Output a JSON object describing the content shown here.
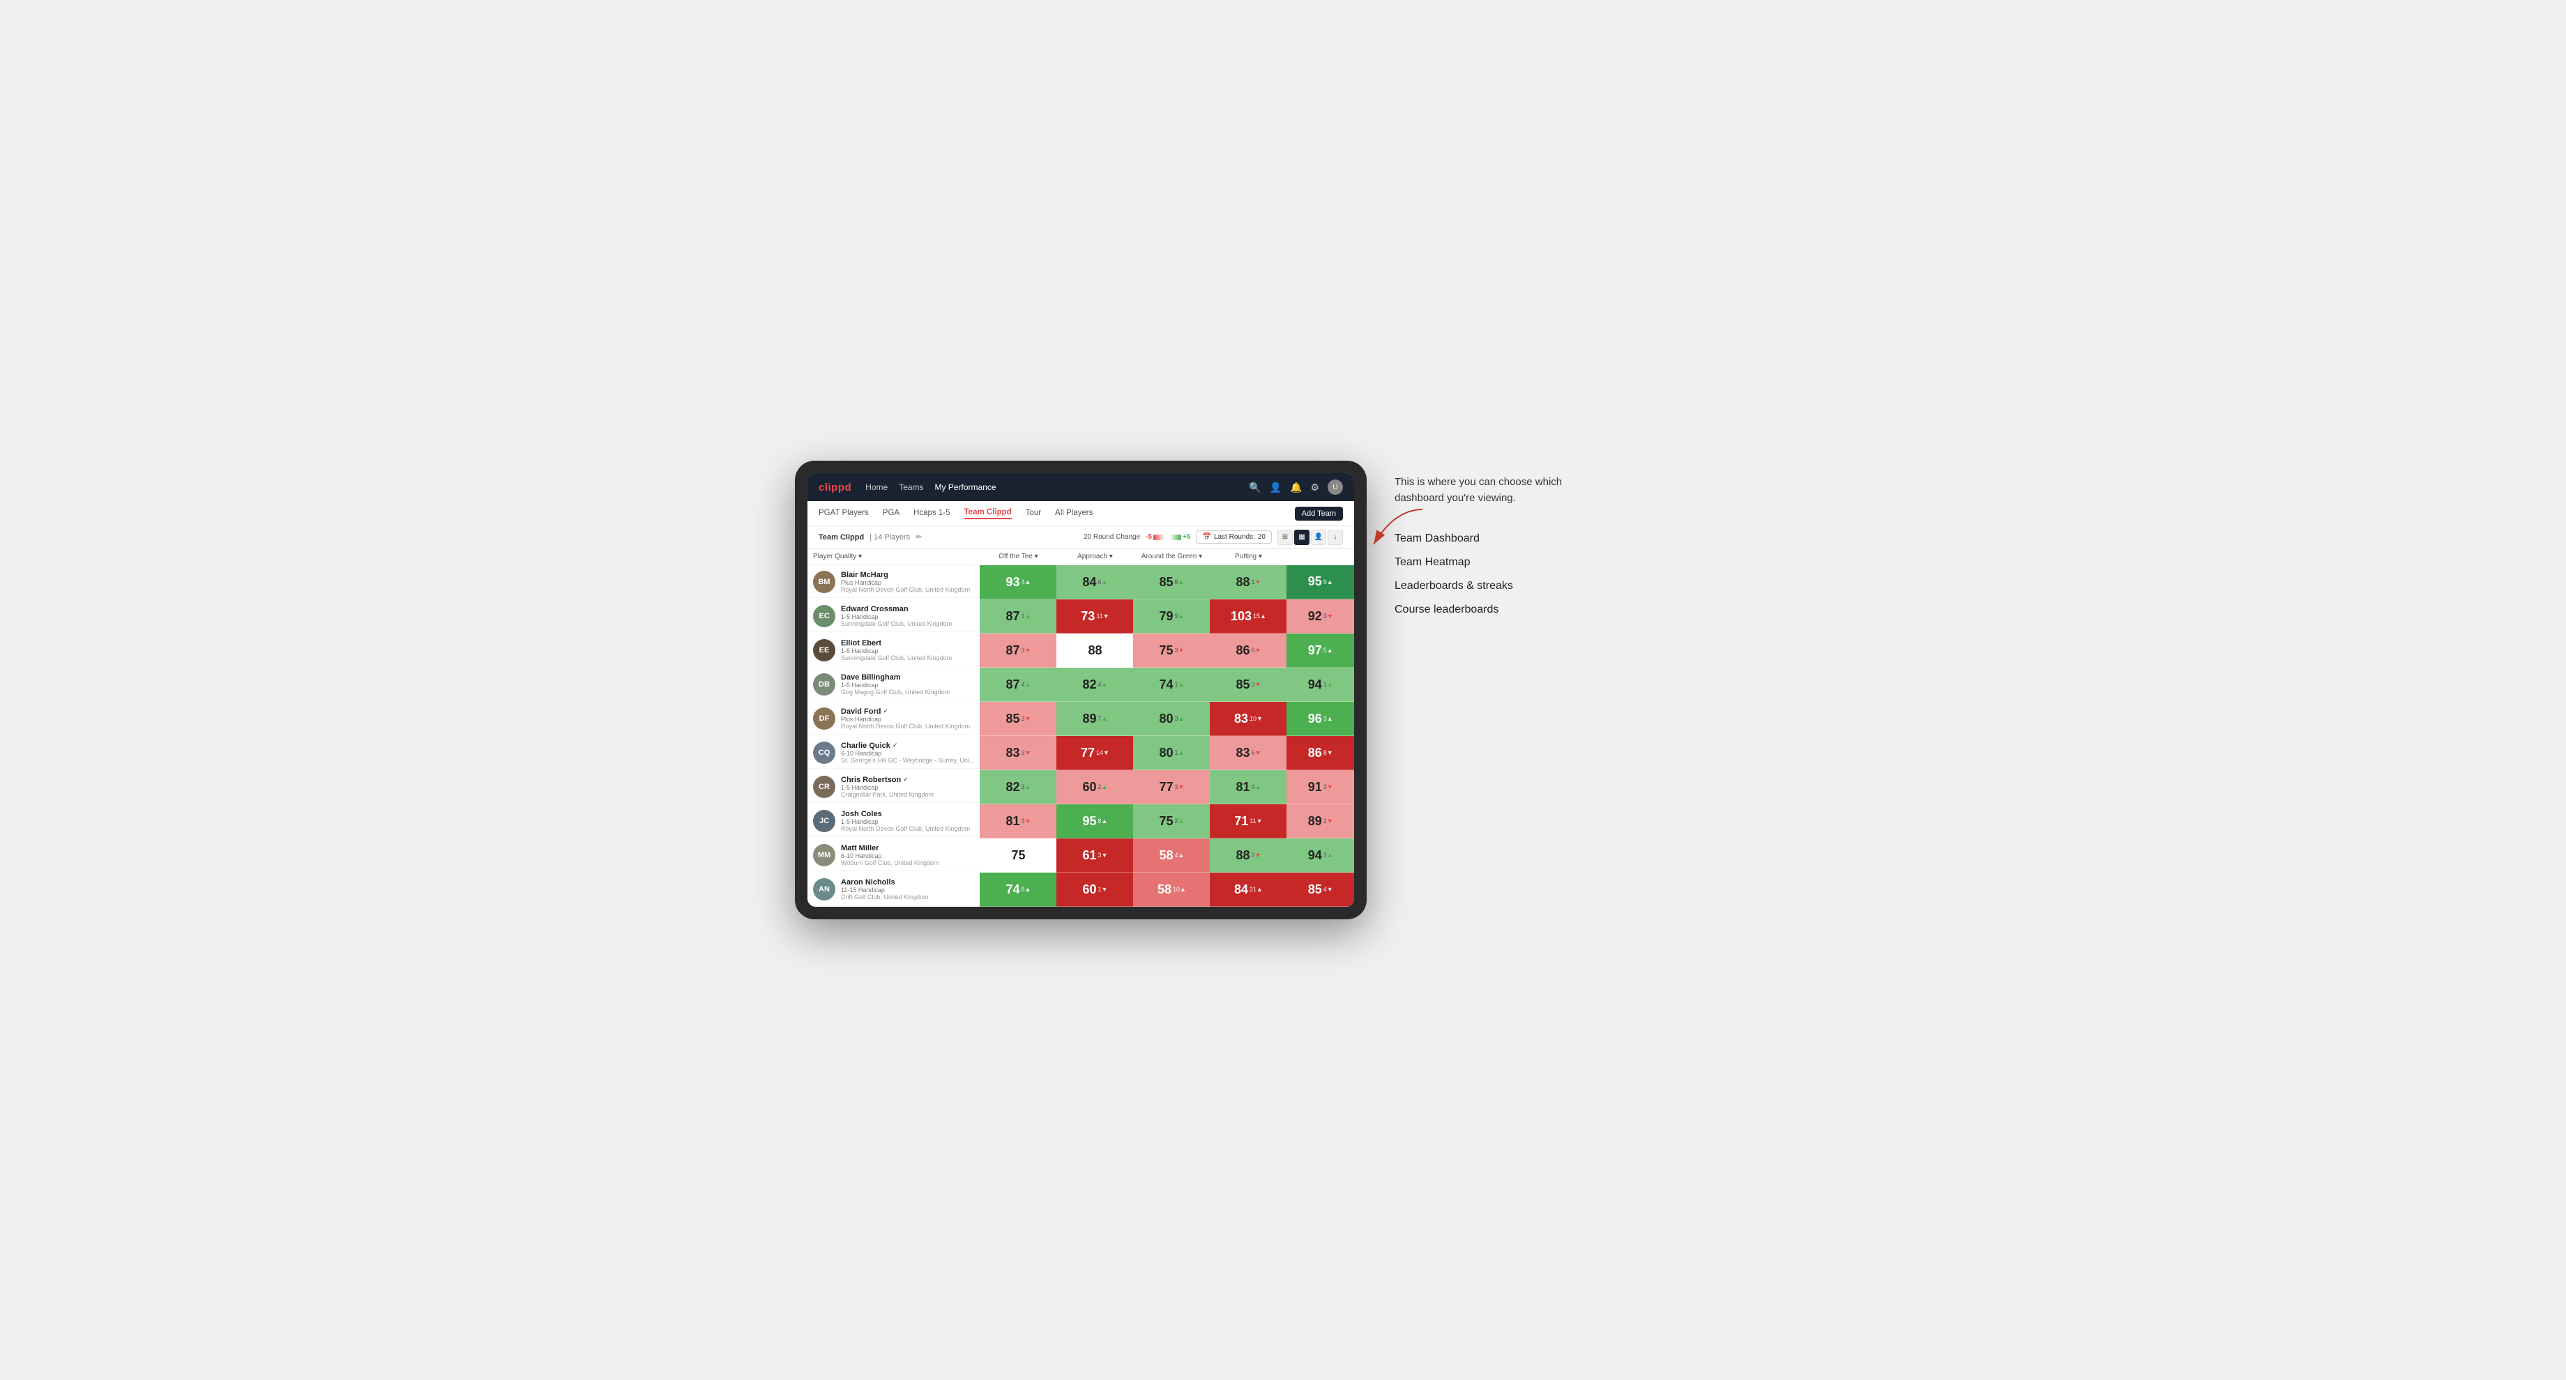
{
  "annotation": {
    "intro": "This is where you can choose which dashboard you're viewing.",
    "items": [
      "Team Dashboard",
      "Team Heatmap",
      "Leaderboards & streaks",
      "Course leaderboards"
    ]
  },
  "nav": {
    "logo": "clippd",
    "links": [
      "Home",
      "Teams",
      "My Performance"
    ],
    "active_link": "My Performance"
  },
  "sub_nav": {
    "links": [
      "PGAT Players",
      "PGA",
      "Hcaps 1-5",
      "Team Clippd",
      "Tour",
      "All Players"
    ],
    "active": "Team Clippd",
    "add_team_label": "Add Team"
  },
  "team_header": {
    "name": "Team Clippd",
    "separator": "|",
    "count": "14 Players",
    "round_change_label": "20 Round Change",
    "scale_neg": "-5",
    "scale_pos": "+5",
    "last_rounds_label": "Last Rounds:",
    "last_rounds_value": "20"
  },
  "table": {
    "columns": {
      "player": "Player Quality ▾",
      "off_tee": "Off the Tee ▾",
      "approach": "Approach ▾",
      "around_green": "Around the Green ▾",
      "putting": "Putting ▾"
    },
    "rows": [
      {
        "name": "Blair McHarg",
        "handicap": "Plus Handicap",
        "club": "Royal North Devon Golf Club, United Kingdom",
        "initials": "BM",
        "avatar_color": "#8B7355",
        "verified": false,
        "scores": [
          {
            "value": "93",
            "change": "4",
            "dir": "up",
            "bg": "green-med"
          },
          {
            "value": "84",
            "change": "6",
            "dir": "up",
            "bg": "green-light"
          },
          {
            "value": "85",
            "change": "8",
            "dir": "up",
            "bg": "green-light"
          },
          {
            "value": "88",
            "change": "1",
            "dir": "down",
            "bg": "green-light"
          },
          {
            "value": "95",
            "change": "9",
            "dir": "up",
            "bg": "green-dark"
          }
        ]
      },
      {
        "name": "Edward Crossman",
        "handicap": "1-5 Handicap",
        "club": "Sunningdale Golf Club, United Kingdom",
        "initials": "EC",
        "avatar_color": "#6B8E6B",
        "verified": false,
        "scores": [
          {
            "value": "87",
            "change": "1",
            "dir": "up",
            "bg": "green-light"
          },
          {
            "value": "73",
            "change": "11",
            "dir": "down",
            "bg": "red-dark"
          },
          {
            "value": "79",
            "change": "9",
            "dir": "up",
            "bg": "green-light"
          },
          {
            "value": "103",
            "change": "15",
            "dir": "up",
            "bg": "red-dark"
          },
          {
            "value": "92",
            "change": "3",
            "dir": "down",
            "bg": "red-light"
          }
        ]
      },
      {
        "name": "Elliot Ebert",
        "handicap": "1-5 Handicap",
        "club": "Sunningdale Golf Club, United Kingdom",
        "initials": "EE",
        "avatar_color": "#5C4A3A",
        "verified": false,
        "scores": [
          {
            "value": "87",
            "change": "3",
            "dir": "down",
            "bg": "red-light"
          },
          {
            "value": "88",
            "change": "",
            "dir": "none",
            "bg": "white"
          },
          {
            "value": "75",
            "change": "3",
            "dir": "down",
            "bg": "red-light"
          },
          {
            "value": "86",
            "change": "6",
            "dir": "down",
            "bg": "red-light"
          },
          {
            "value": "97",
            "change": "5",
            "dir": "up",
            "bg": "green-med"
          }
        ]
      },
      {
        "name": "Dave Billingham",
        "handicap": "1-5 Handicap",
        "club": "Gog Magog Golf Club, United Kingdom",
        "initials": "DB",
        "avatar_color": "#7A8B7A",
        "verified": false,
        "scores": [
          {
            "value": "87",
            "change": "4",
            "dir": "up",
            "bg": "green-light"
          },
          {
            "value": "82",
            "change": "4",
            "dir": "up",
            "bg": "green-light"
          },
          {
            "value": "74",
            "change": "1",
            "dir": "up",
            "bg": "green-light"
          },
          {
            "value": "85",
            "change": "3",
            "dir": "down",
            "bg": "green-light"
          },
          {
            "value": "94",
            "change": "1",
            "dir": "up",
            "bg": "green-light"
          }
        ]
      },
      {
        "name": "David Ford",
        "handicap": "Plus Handicap",
        "club": "Royal North Devon Golf Club, United Kingdom",
        "initials": "DF",
        "avatar_color": "#8B7355",
        "verified": true,
        "scores": [
          {
            "value": "85",
            "change": "3",
            "dir": "down",
            "bg": "red-light"
          },
          {
            "value": "89",
            "change": "7",
            "dir": "up",
            "bg": "green-light"
          },
          {
            "value": "80",
            "change": "3",
            "dir": "up",
            "bg": "green-light"
          },
          {
            "value": "83",
            "change": "10",
            "dir": "down",
            "bg": "red-dark"
          },
          {
            "value": "96",
            "change": "3",
            "dir": "up",
            "bg": "green-med"
          }
        ]
      },
      {
        "name": "Charlie Quick",
        "handicap": "6-10 Handicap",
        "club": "St. George's Hill GC - Weybridge - Surrey, Uni...",
        "initials": "CQ",
        "avatar_color": "#6B7B8B",
        "verified": true,
        "scores": [
          {
            "value": "83",
            "change": "3",
            "dir": "down",
            "bg": "red-light"
          },
          {
            "value": "77",
            "change": "14",
            "dir": "down",
            "bg": "red-dark"
          },
          {
            "value": "80",
            "change": "1",
            "dir": "up",
            "bg": "green-light"
          },
          {
            "value": "83",
            "change": "6",
            "dir": "down",
            "bg": "red-light"
          },
          {
            "value": "86",
            "change": "8",
            "dir": "down",
            "bg": "red-dark"
          }
        ]
      },
      {
        "name": "Chris Robertson",
        "handicap": "1-5 Handicap",
        "club": "Craigmillar Park, United Kingdom",
        "initials": "CR",
        "avatar_color": "#7A6B5A",
        "verified": true,
        "scores": [
          {
            "value": "82",
            "change": "3",
            "dir": "up",
            "bg": "green-light"
          },
          {
            "value": "60",
            "change": "2",
            "dir": "up",
            "bg": "red-light"
          },
          {
            "value": "77",
            "change": "3",
            "dir": "down",
            "bg": "red-light"
          },
          {
            "value": "81",
            "change": "4",
            "dir": "up",
            "bg": "green-light"
          },
          {
            "value": "91",
            "change": "3",
            "dir": "down",
            "bg": "red-light"
          }
        ]
      },
      {
        "name": "Josh Coles",
        "handicap": "1-5 Handicap",
        "club": "Royal North Devon Golf Club, United Kingdom",
        "initials": "JC",
        "avatar_color": "#5A6B7A",
        "verified": false,
        "scores": [
          {
            "value": "81",
            "change": "3",
            "dir": "down",
            "bg": "red-light"
          },
          {
            "value": "95",
            "change": "8",
            "dir": "up",
            "bg": "green-med"
          },
          {
            "value": "75",
            "change": "2",
            "dir": "up",
            "bg": "green-light"
          },
          {
            "value": "71",
            "change": "11",
            "dir": "down",
            "bg": "red-dark"
          },
          {
            "value": "89",
            "change": "2",
            "dir": "down",
            "bg": "red-light"
          }
        ]
      },
      {
        "name": "Matt Miller",
        "handicap": "6-10 Handicap",
        "club": "Woburn Golf Club, United Kingdom",
        "initials": "MM",
        "avatar_color": "#8B8B7A",
        "verified": false,
        "scores": [
          {
            "value": "75",
            "change": "",
            "dir": "none",
            "bg": "white"
          },
          {
            "value": "61",
            "change": "3",
            "dir": "down",
            "bg": "red-dark"
          },
          {
            "value": "58",
            "change": "4",
            "dir": "up",
            "bg": "red-med"
          },
          {
            "value": "88",
            "change": "2",
            "dir": "down",
            "bg": "green-light"
          },
          {
            "value": "94",
            "change": "3",
            "dir": "up",
            "bg": "green-light"
          }
        ]
      },
      {
        "name": "Aaron Nicholls",
        "handicap": "11-15 Handicap",
        "club": "Drift Golf Club, United Kingdom",
        "initials": "AN",
        "avatar_color": "#6B8B8B",
        "verified": false,
        "scores": [
          {
            "value": "74",
            "change": "8",
            "dir": "up",
            "bg": "green-med"
          },
          {
            "value": "60",
            "change": "1",
            "dir": "down",
            "bg": "red-dark"
          },
          {
            "value": "58",
            "change": "10",
            "dir": "up",
            "bg": "red-med"
          },
          {
            "value": "84",
            "change": "21",
            "dir": "up",
            "bg": "red-dark"
          },
          {
            "value": "85",
            "change": "4",
            "dir": "down",
            "bg": "red-dark"
          }
        ]
      }
    ]
  }
}
